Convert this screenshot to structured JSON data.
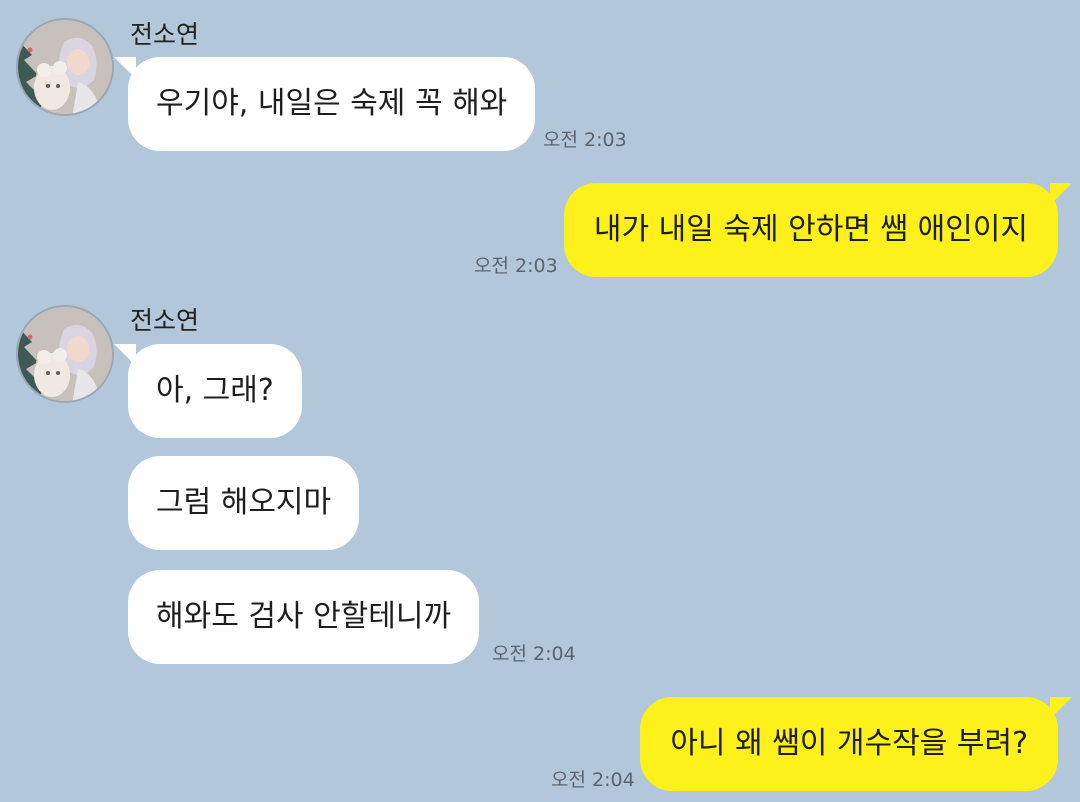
{
  "chat": {
    "background": "#b2c7da",
    "incoming_bubble_color": "#ffffff",
    "outgoing_bubble_color": "#fef01b",
    "messages": [
      {
        "sender": "전소연",
        "text": "우기야, 내일은 숙제 꼭 해와",
        "time": "오전 2:03"
      },
      {
        "text": "내가 내일 숙제 안하면 쌤 애인이지",
        "time": "오전 2:03"
      },
      {
        "sender": "전소연",
        "text": "아, 그래?"
      },
      {
        "text": "그럼 해오지마"
      },
      {
        "text": "해와도 검사 안할테니까",
        "time": "오전 2:04"
      },
      {
        "text": "아니 왜 쌤이 개수작을 부려?",
        "time": "오전 2:04"
      }
    ]
  }
}
